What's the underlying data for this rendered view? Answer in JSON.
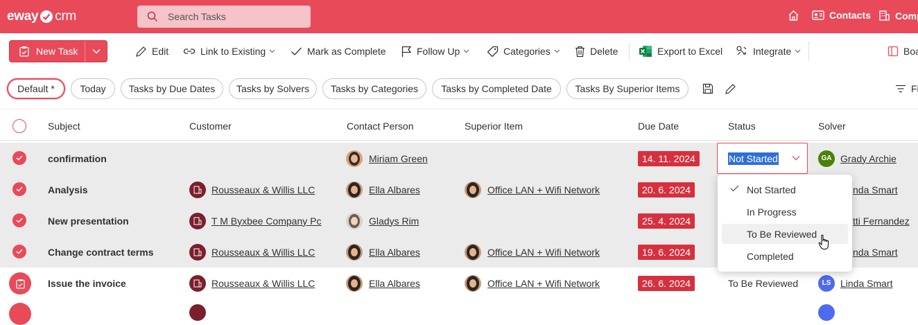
{
  "app": {
    "logo_text_a": "eway",
    "logo_text_b": "crm"
  },
  "search": {
    "placeholder": "Search Tasks"
  },
  "nav": {
    "contacts": "Contacts",
    "companies": "Comp"
  },
  "toolbar": {
    "new_task": "New Task",
    "edit": "Edit",
    "link_existing": "Link to Existing",
    "mark_complete": "Mark as Complete",
    "follow_up": "Follow Up",
    "categories": "Categories",
    "delete": "Delete",
    "export_excel": "Export to Excel",
    "integrate": "Integrate",
    "board": "Boa"
  },
  "filters": {
    "default": "Default *",
    "today": "Today",
    "by_due": "Tasks by Due Dates",
    "by_solvers": "Tasks by Solvers",
    "by_categories": "Tasks by Categories",
    "by_completed": "Tasks by Completed Date",
    "by_superior": "Tasks By Superior Items",
    "filter": "Fi"
  },
  "columns": {
    "subject": "Subject",
    "customer": "Customer",
    "contact": "Contact Person",
    "superior": "Superior Item",
    "due": "Due Date",
    "status": "Status",
    "solver": "Solver"
  },
  "rows": [
    {
      "subject": "confirmation",
      "customer": "",
      "contact": "Miriam Green",
      "superior": "",
      "due": "14. 11. 2024",
      "status": "",
      "solver": "Grady Archie",
      "solver_initials": "GA"
    },
    {
      "subject": "Analysis",
      "customer": "Rousseaux & Willis LLC",
      "contact": "Ella Albares",
      "superior": "Office LAN + Wifi Network",
      "due": "20. 6. 2024",
      "status": "",
      "solver": "nda Smart"
    },
    {
      "subject": "New presentation",
      "customer": "T M Byxbee Company Pc",
      "contact": "Gladys Rim",
      "superior": "",
      "due": "25. 4. 2024",
      "status": "",
      "solver": "tti Fernandez"
    },
    {
      "subject": "Change contract terms",
      "customer": "Rousseaux & Willis LLC",
      "contact": "Ella Albares",
      "superior": "Office LAN + Wifi Network",
      "due": "19. 6. 2024",
      "status": "",
      "solver": "nda Smart"
    },
    {
      "subject": "Issue the invoice",
      "customer": "Rousseaux & Willis LLC",
      "contact": "Ella Albares",
      "superior": "Office LAN + Wifi Network",
      "due": "26. 6. 2024",
      "status": "To Be Reviewed",
      "solver": "Linda Smart",
      "solver_initials": "LS"
    }
  ],
  "status_editor": {
    "value": "Not Started"
  },
  "status_options": [
    "Not Started",
    "In Progress",
    "To Be Reviewed",
    "Completed"
  ],
  "colors": {
    "brand": "#e84a5a",
    "due_badge": "#d6303f",
    "customer_icon": "#7a1f2c"
  }
}
